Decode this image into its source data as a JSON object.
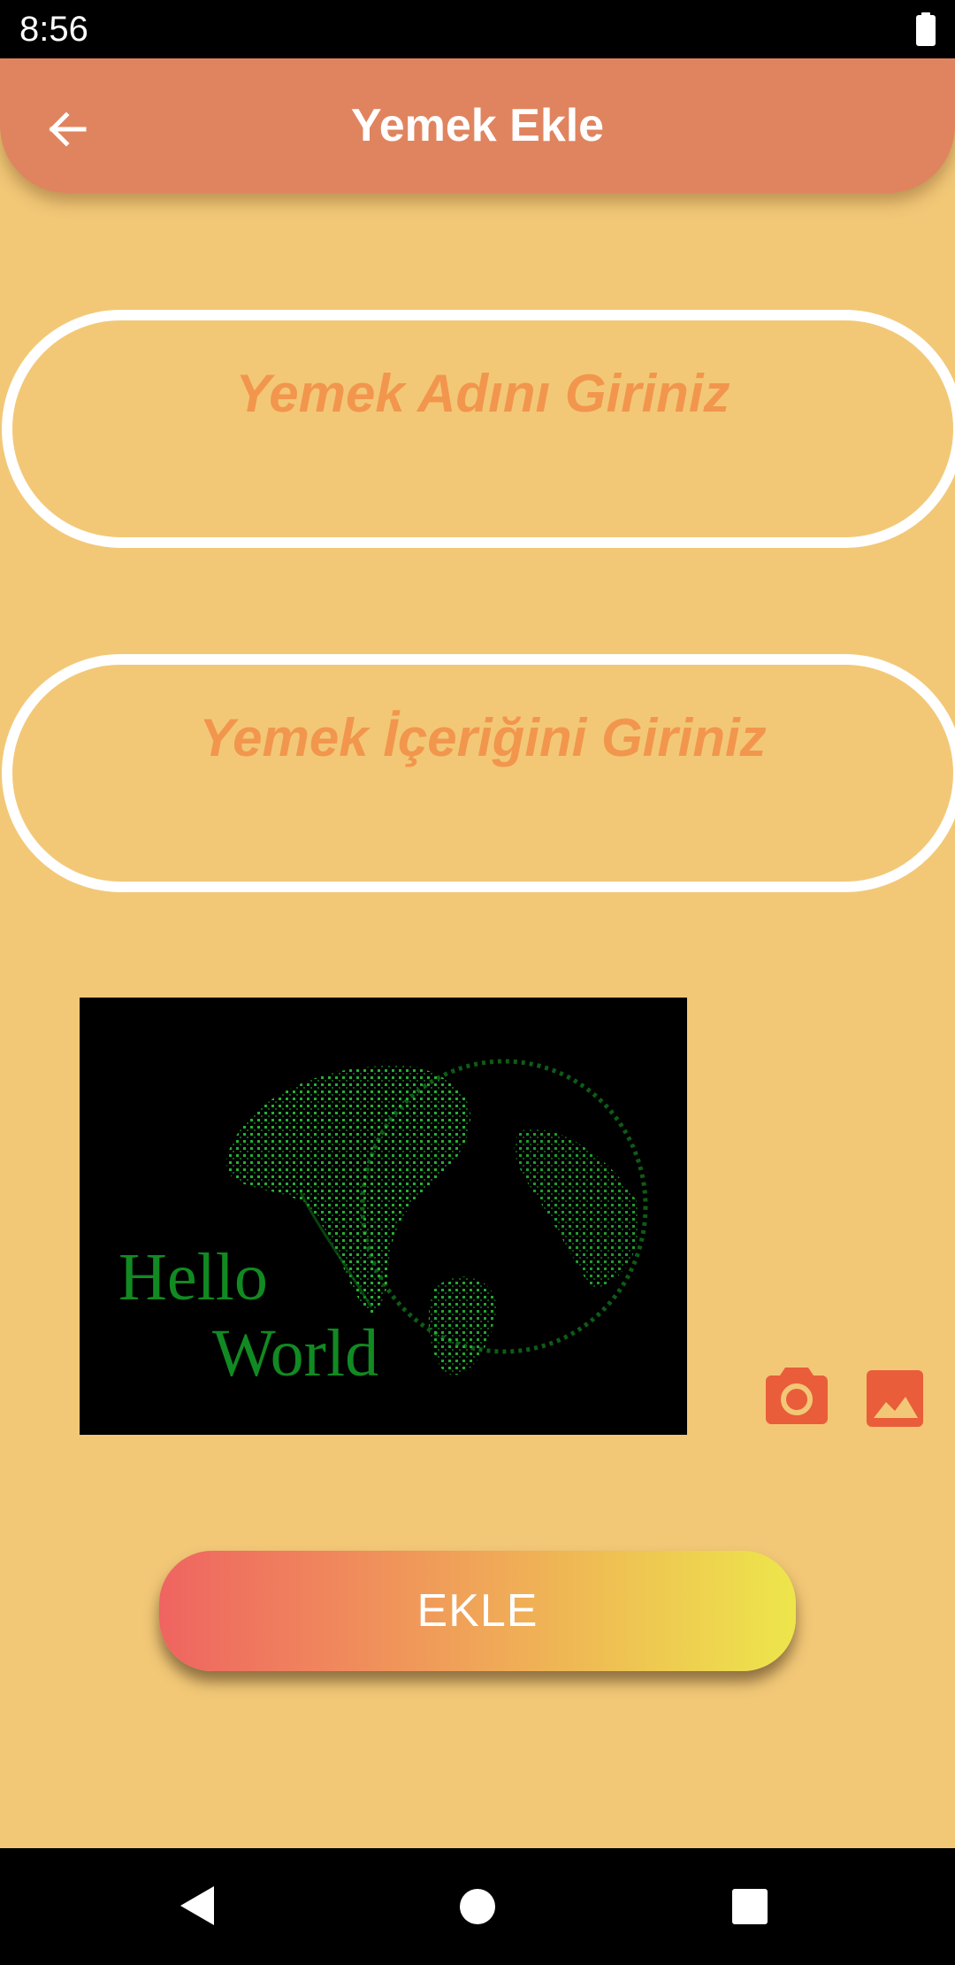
{
  "status_bar": {
    "time": "8:56",
    "battery_icon": "battery-full-icon"
  },
  "app_bar": {
    "title": "Yemek Ekle",
    "back_icon": "arrow-left-icon"
  },
  "form": {
    "name_field": {
      "placeholder": "Yemek Adını Giriniz",
      "value": ""
    },
    "content_field": {
      "placeholder": "Yemek İçeriğini Giriniz",
      "value": ""
    }
  },
  "image_preview": {
    "line1": "Hello",
    "line2": "World"
  },
  "image_actions": {
    "camera_icon": "camera-icon",
    "gallery_icon": "image-gallery-icon"
  },
  "submit": {
    "label": "EKLE"
  },
  "nav_bar": {
    "back_icon": "triangle-back-icon",
    "home_icon": "circle-home-icon",
    "recents_icon": "square-recents-icon"
  },
  "colors": {
    "background": "#f2c877",
    "app_bar": "#e0845f",
    "placeholder": "#f2964d",
    "icon_accent": "#e95d3a",
    "button_gradient": [
      "#ef6461",
      "#f0a558",
      "#ede64b"
    ],
    "preview_text": "#118a22"
  }
}
